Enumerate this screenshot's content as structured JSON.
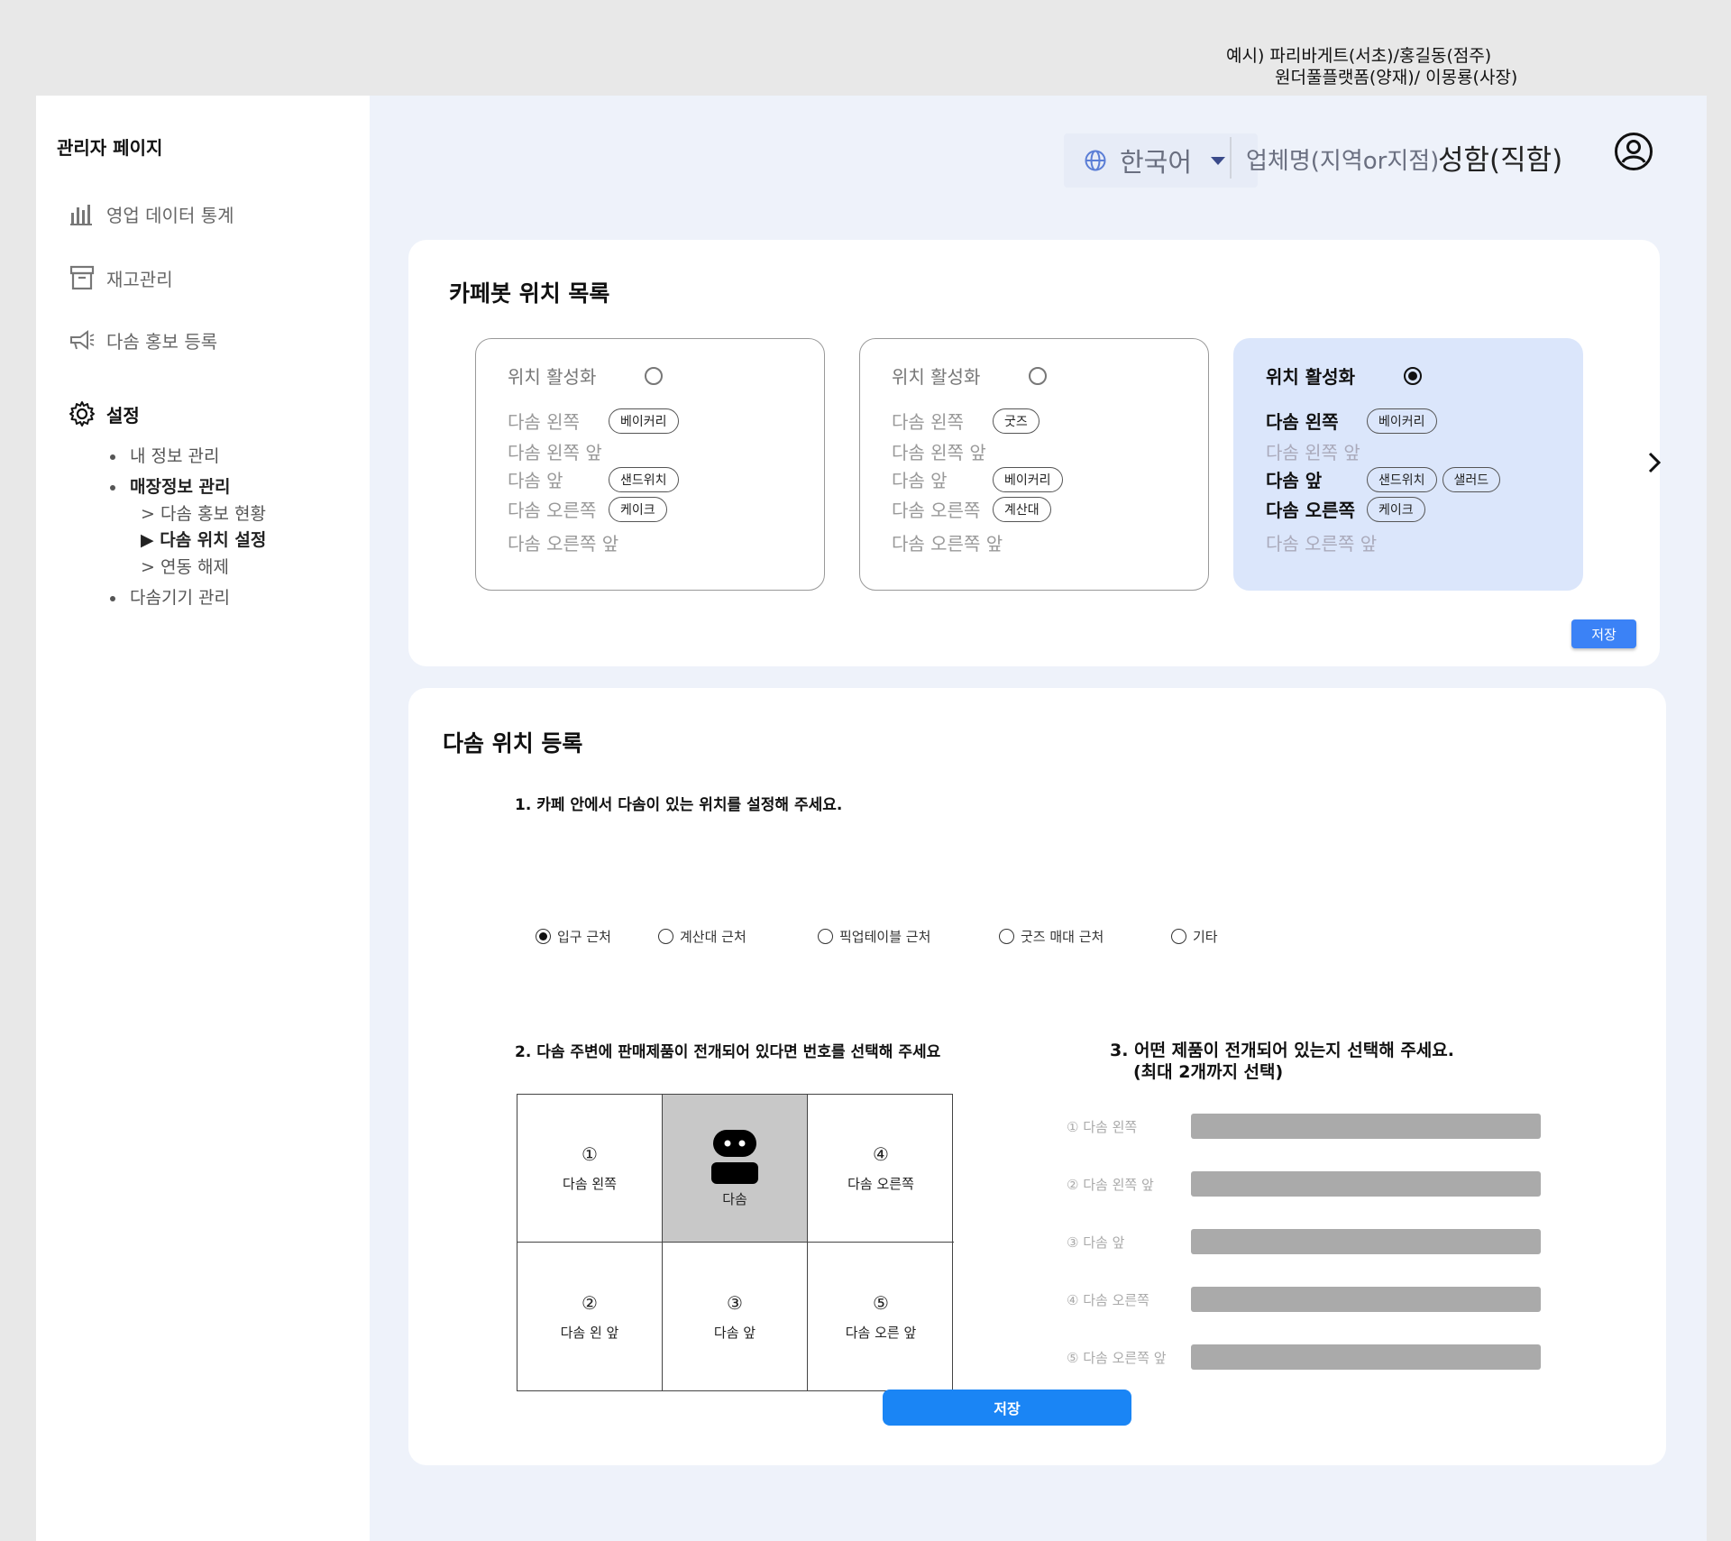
{
  "note": {
    "line1": "예시) 파리바게트(서초)/홍길동(점주)",
    "line2": "원더풀플랫폼(양재)/ 이몽룡(사장)"
  },
  "sidebar": {
    "title": "관리자 페이지",
    "items": [
      {
        "label": "영업 데이터 통계",
        "icon": "bar-chart-icon"
      },
      {
        "label": "재고관리",
        "icon": "archive-box-icon"
      },
      {
        "label": "다솜 홍보 등록",
        "icon": "megaphone-icon"
      },
      {
        "label": "설정",
        "icon": "gear-icon"
      }
    ],
    "settings": {
      "my_info": "내 정보 관리",
      "store_info": "매장정보 관리",
      "promo_status": "> 다솜 홍보 현황",
      "location_setting": "▶ 다솜 위치 설정",
      "unlink": "> 연동 해제",
      "device_mgmt": "다솜기기 관리"
    }
  },
  "header": {
    "language": "한국어",
    "company": "업체명(지역or지점)",
    "user": "성함(직함)"
  },
  "location_list": {
    "title": "카페봇 위치 목록",
    "activate_label": "위치 활성화",
    "cards": [
      {
        "active": false,
        "rows": [
          {
            "label": "다솜 왼쪽",
            "chips": [
              "베이커리"
            ]
          },
          {
            "label": "다솜 왼쪽 앞",
            "chips": []
          },
          {
            "label": "다솜 앞",
            "chips": [
              "샌드위치"
            ]
          },
          {
            "label": "다솜 오른쪽",
            "chips": [
              "케이크"
            ]
          },
          {
            "label": "다솜 오른쪽 앞",
            "chips": []
          }
        ]
      },
      {
        "active": false,
        "rows": [
          {
            "label": "다솜 왼쪽",
            "chips": [
              "굿즈"
            ]
          },
          {
            "label": "다솜 왼쪽 앞",
            "chips": []
          },
          {
            "label": "다솜 앞",
            "chips": [
              "베이커리"
            ]
          },
          {
            "label": "다솜 오른쪽",
            "chips": [
              "계산대"
            ]
          },
          {
            "label": "다솜 오른쪽 앞",
            "chips": []
          }
        ]
      },
      {
        "active": true,
        "rows": [
          {
            "label": "다솜 왼쪽",
            "chips": [
              "베이커리"
            ]
          },
          {
            "label": "다솜 왼쪽 앞",
            "chips": []
          },
          {
            "label": "다솜 앞",
            "chips": [
              "샌드위치",
              "샐러드"
            ]
          },
          {
            "label": "다솜 오른쪽",
            "chips": [
              "케이크"
            ]
          },
          {
            "label": "다솜 오른쪽 앞",
            "chips": []
          }
        ]
      }
    ],
    "save": "저장"
  },
  "registration": {
    "title": "다솜 위치 등록",
    "q1": "1. 카페 안에서 다솜이 있는 위치를 설정해 주세요.",
    "q1_options": [
      {
        "label": "입구 근처",
        "selected": true
      },
      {
        "label": "계산대  근처",
        "selected": false
      },
      {
        "label": "픽업테이블 근처",
        "selected": false
      },
      {
        "label": "굿즈 매대 근처",
        "selected": false
      },
      {
        "label": "기타",
        "selected": false
      }
    ],
    "q2": "2. 다솜 주변에 판매제품이 전개되어 있다면 번호를 선택해 주세요",
    "grid": {
      "c1_num": "①",
      "c1_label": "다솜 왼쪽",
      "center_label": "다솜",
      "c4_num": "④",
      "c4_label": "다솜 오른쪽",
      "c2_num": "②",
      "c2_label": "다솜 왼 앞",
      "c3_num": "③",
      "c3_label": "다솜 앞",
      "c5_num": "⑤",
      "c5_label": "다솜 오른 앞"
    },
    "q3_line1": "3. 어떤 제품이 전개되어 있는지 선택해 주세요.",
    "q3_line2": "(최대 2개까지 선택)",
    "q3_rows": [
      "① 다솜 왼쪽",
      "② 다솜 왼쪽 앞",
      "③ 다솜 앞",
      "④ 다솜 오른쪽",
      "⑤ 다솜 오른쪽 앞"
    ],
    "save": "저장"
  },
  "colors": {
    "accent": "#1a85f5",
    "selected_card": "#dbe6fb",
    "content_bg": "#eef2fa"
  }
}
